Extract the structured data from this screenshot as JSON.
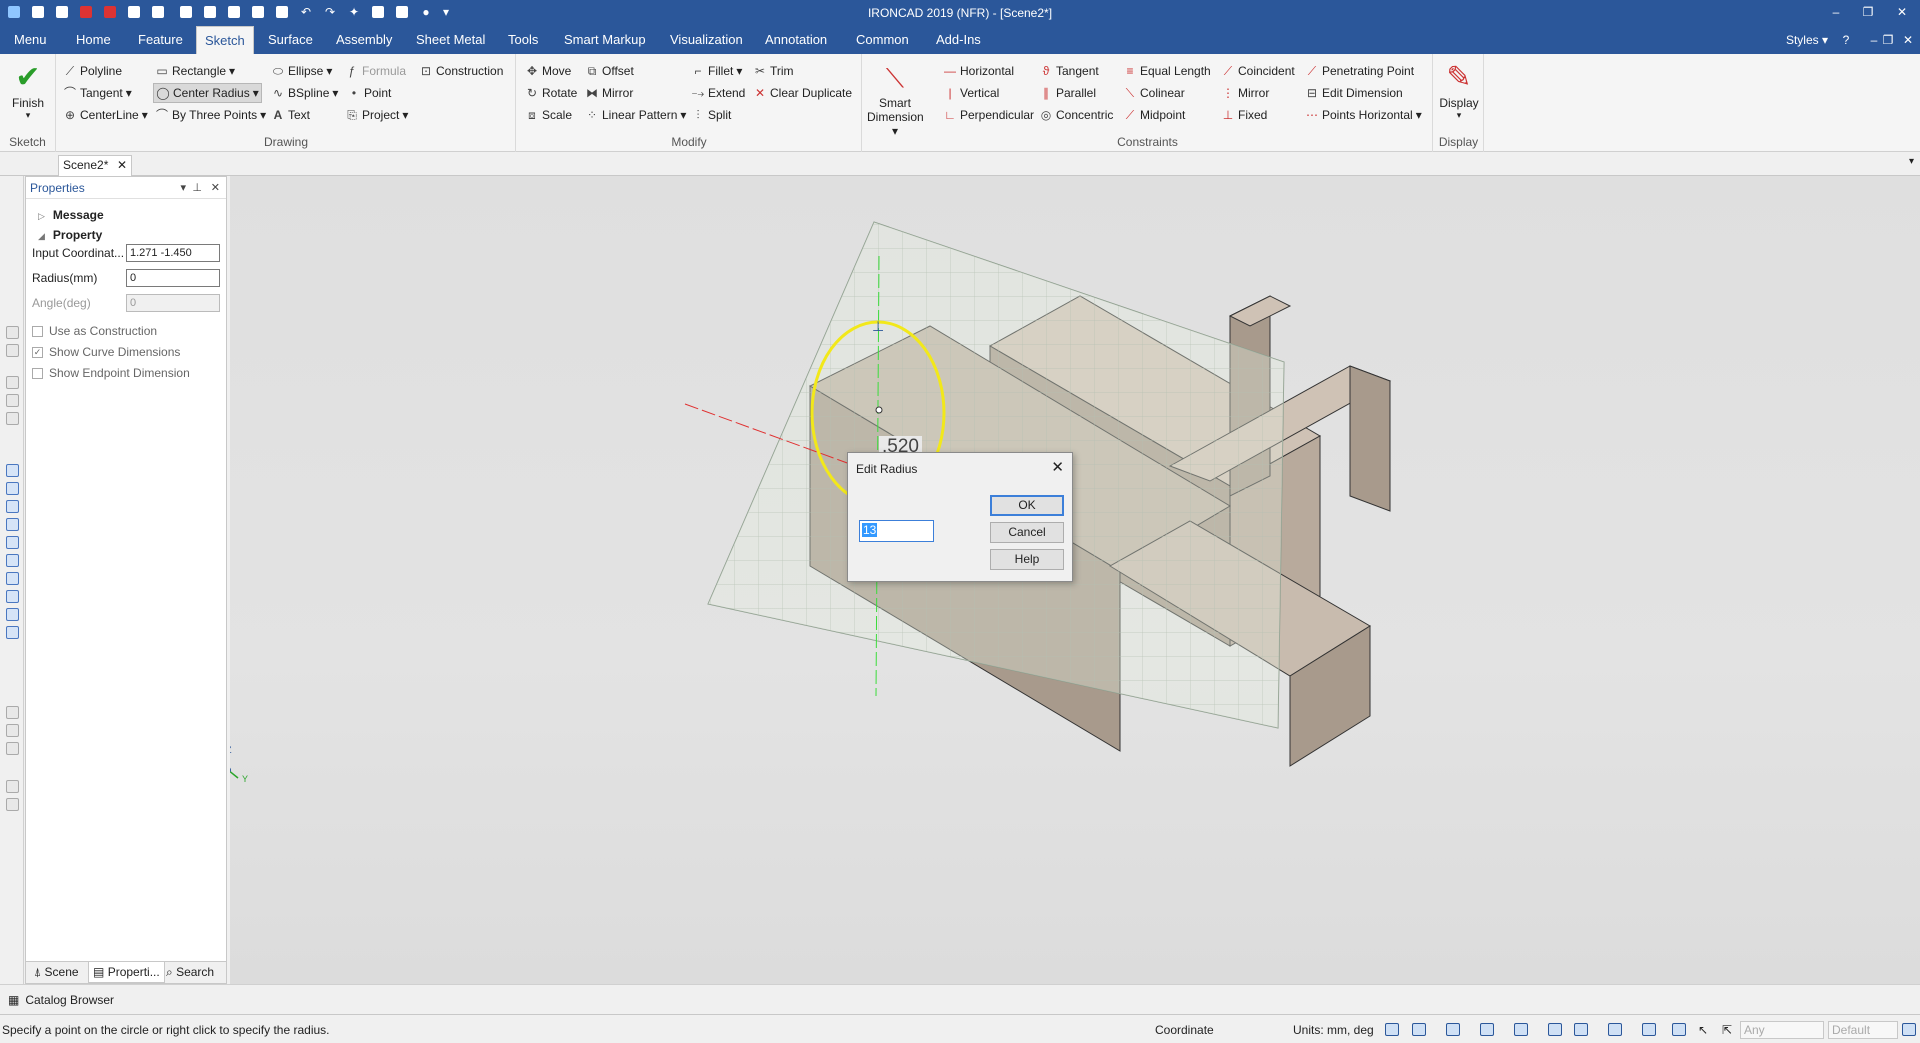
{
  "window": {
    "title": "IRONCAD 2019 (NFR) - [Scene2*]"
  },
  "menu": {
    "tabs": [
      "Menu",
      "Home",
      "Feature",
      "Sketch",
      "Surface",
      "Assembly",
      "Sheet Metal",
      "Tools",
      "Smart Markup",
      "Visualization",
      "Annotation",
      "Common",
      "Add-Ins"
    ],
    "active": "Sketch",
    "styles_label": "Styles"
  },
  "ribbon": {
    "sketch": {
      "finish": "Finish",
      "label": "Sketch"
    },
    "drawing": {
      "label": "Drawing",
      "items": [
        "Polyline",
        "Rectangle",
        "Formula",
        "Construction",
        "Ellipse",
        "Tangent",
        "Center Radius",
        "BSpline",
        "Point",
        "CenterLine",
        "By Three Points",
        "Text",
        "Project"
      ]
    },
    "modify": {
      "label": "Modify",
      "items": [
        "Move",
        "Offset",
        "Fillet",
        "Trim",
        "Rotate",
        "Mirror",
        "Extend",
        "Clear Duplicate",
        "Scale",
        "Linear Pattern",
        "Split"
      ]
    },
    "constraints": {
      "label": "Constraints",
      "smart_dim": [
        "Smart",
        "Dimension"
      ],
      "items": [
        "Horizontal",
        "Tangent",
        "Equal Length",
        "Coincident",
        "Penetrating Point",
        "Vertical",
        "Parallel",
        "Colinear",
        "Mirror",
        "Edit Dimension",
        "Perpendicular",
        "Concentric",
        "Midpoint",
        "Fixed",
        "Points Horizontal"
      ]
    },
    "display": {
      "button": "Display",
      "label": "Display"
    }
  },
  "document": {
    "tab": "Scene2*"
  },
  "properties": {
    "title": "Properties",
    "sections": {
      "message": "Message",
      "property": "Property"
    },
    "fields": {
      "input_coord_label": "Input Coordinat...",
      "input_coord_value": "1.271 -1.450",
      "radius_label": "Radius(mm)",
      "radius_value": "0",
      "angle_label": "Angle(deg)",
      "angle_value": "0"
    },
    "checkboxes": {
      "use_construction": "Use as Construction",
      "show_curve_dims": "Show Curve Dimensions",
      "show_endpoint_dims": "Show Endpoint Dimension"
    },
    "tabs": {
      "scene": "Scene",
      "properties": "Properti...",
      "search": "Search"
    }
  },
  "viewport": {
    "dimension_text": ".520",
    "axes": {
      "z": "Z",
      "x": "X",
      "y": "Y"
    }
  },
  "dialog": {
    "title": "Edit Radius",
    "value": "13",
    "ok": "OK",
    "cancel": "Cancel",
    "help": "Help"
  },
  "catalog": {
    "label": "Catalog Browser"
  },
  "status": {
    "hint": "Specify a point on the circle or right click to specify the radius.",
    "coordinate": "Coordinate",
    "units": "Units: mm, deg",
    "field1": "Any",
    "field2": "Default"
  },
  "colors": {
    "accent": "#2b579a",
    "sketch_circle": "#f2e81a",
    "part_face": "#a89a8c"
  }
}
